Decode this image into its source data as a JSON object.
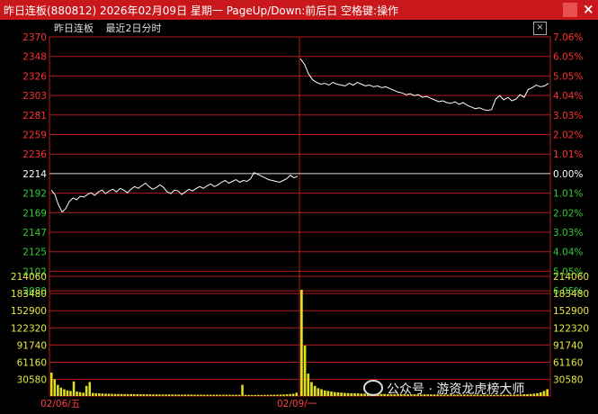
{
  "window": {
    "title": "昨日连板(880812)  2026年02月09日  星期一  PageUp/Down:前后日  空格键:操作",
    "close_glyph": "×"
  },
  "chart_header": {
    "name": "昨日连板",
    "subtitle": "最近2日分时",
    "close_glyph": "×"
  },
  "watermark": {
    "text": "公众号 · 游资龙虎榜大师"
  },
  "colors": {
    "background": "#000000",
    "titlebar": "#c9181b",
    "grid": "#b31c1c",
    "up": "#ff3030",
    "down": "#33cc33",
    "price_line": "#ffffff",
    "volume": "#e0e020"
  },
  "chart_data": {
    "type": "line",
    "price_axis": {
      "ylim": [
        2080,
        2370
      ],
      "prev_close": 2214,
      "ticks_left": [
        "2370",
        "2348",
        "2326",
        "2303",
        "2281",
        "2259",
        "2236",
        "2214",
        "2192",
        "2169",
        "2147",
        "2125",
        "2102",
        "2080"
      ],
      "ticks_right": [
        "7.06%",
        "6.05%",
        "5.05%",
        "4.04%",
        "3.03%",
        "2.02%",
        "1.01%",
        "0.00%",
        "1.01%",
        "2.02%",
        "3.03%",
        "4.04%",
        "5.05%",
        "6.05%"
      ]
    },
    "volume_axis": {
      "ylim": [
        0,
        214060
      ],
      "ticks_left": [
        "214060",
        "183480",
        "152900",
        "122320",
        "91740",
        "61160",
        "30580"
      ],
      "ticks_right": [
        "214060",
        "183480",
        "152900",
        "122320",
        "91740",
        "61160",
        "30580"
      ]
    },
    "x_labels": [
      "02/06/五",
      "02/09/一"
    ],
    "day1_price": [
      2195,
      2190,
      2178,
      2170,
      2174,
      2182,
      2186,
      2184,
      2188,
      2187,
      2190,
      2192,
      2189,
      2193,
      2195,
      2191,
      2194,
      2196,
      2193,
      2197,
      2195,
      2192,
      2196,
      2199,
      2197,
      2200,
      2203,
      2199,
      2196,
      2198,
      2201,
      2198,
      2193,
      2191,
      2195,
      2194,
      2190,
      2193,
      2196,
      2194,
      2197,
      2199,
      2197,
      2200,
      2202,
      2199,
      2201,
      2204,
      2206,
      2203,
      2205,
      2207,
      2204,
      2206,
      2205,
      2208,
      2215,
      2213,
      2211,
      2209,
      2207,
      2206,
      2205,
      2204,
      2206,
      2208,
      2212,
      2209,
      2211
    ],
    "day2_price": [
      2345,
      2339,
      2328,
      2321,
      2318,
      2316,
      2317,
      2315,
      2318,
      2316,
      2315,
      2314,
      2317,
      2315,
      2318,
      2316,
      2314,
      2315,
      2313,
      2314,
      2312,
      2313,
      2311,
      2309,
      2307,
      2306,
      2304,
      2305,
      2303,
      2304,
      2301,
      2302,
      2300,
      2298,
      2296,
      2297,
      2295,
      2294,
      2296,
      2293,
      2295,
      2292,
      2290,
      2288,
      2289,
      2287,
      2286,
      2287,
      2299,
      2303,
      2298,
      2301,
      2297,
      2299,
      2304,
      2301,
      2310,
      2312,
      2315,
      2313,
      2314,
      2317
    ],
    "day1_volume": [
      42000,
      30000,
      20000,
      15000,
      12000,
      10000,
      9000,
      26000,
      8000,
      7000,
      6000,
      18000,
      25000,
      5500,
      5000,
      4800,
      4500,
      4200,
      4000,
      3800,
      3700,
      3600,
      3500,
      3400,
      3300,
      3300,
      3200,
      3200,
      3100,
      3100,
      3000,
      3000,
      2900,
      2900,
      2800,
      2800,
      2700,
      2700,
      2700,
      2600,
      2600,
      2600,
      2500,
      2500,
      2500,
      2400,
      2400,
      2400,
      2300,
      2300,
      2300,
      2300,
      2200,
      2200,
      2200,
      2200,
      2200,
      2100,
      2100,
      2100,
      20000,
      2100,
      2000,
      2000,
      2000,
      2000,
      2000,
      2000,
      2100,
      2200,
      2300,
      2400,
      2600,
      2800,
      3000,
      3500,
      4000,
      6000
    ],
    "day2_volume": [
      190000,
      90000,
      40000,
      25000,
      18000,
      14000,
      12000,
      10000,
      9000,
      8000,
      7000,
      6500,
      6000,
      5500,
      5200,
      5000,
      4800,
      4600,
      4400,
      4200,
      4000,
      3900,
      3800,
      3700,
      3600,
      3500,
      3400,
      3400,
      3300,
      3300,
      3200,
      3200,
      3100,
      3100,
      3000,
      3000,
      2900,
      2900,
      2800,
      2800,
      2800,
      2700,
      2700,
      2700,
      2600,
      2600,
      2600,
      2600,
      2500,
      2500,
      2500,
      2500,
      2400,
      2400,
      2400,
      2400,
      2400,
      2300,
      2300,
      2300,
      2300,
      2300,
      2300,
      2400,
      2500,
      2600,
      2800,
      3000,
      3200,
      3600,
      4200,
      5000,
      6500,
      9000,
      12000
    ]
  }
}
